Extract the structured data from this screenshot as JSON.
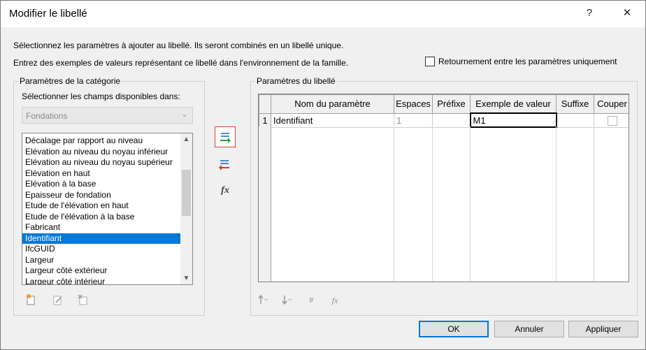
{
  "window": {
    "title": "Modifier le libellé",
    "help_glyph": "?",
    "close_glyph": "✕"
  },
  "instructions": {
    "line1": "Sélectionnez les paramètres à ajouter au libellé. Ils seront combinés en un libellé unique.",
    "line2": "Entrez des exemples de valeurs représentant ce libellé dans l'environnement de la famille."
  },
  "wrap_option": {
    "label": "Retournement entre les paramètres uniquement",
    "checked": false
  },
  "category_panel": {
    "title": "Paramètres de la catégorie",
    "select_label": "Sélectionner les champs disponibles dans:",
    "dropdown_value": "Fondations",
    "items": [
      "Décalage par rapport au niveau",
      "Elévation au niveau du noyau inférieur",
      "Elévation au niveau du noyau supérieur",
      "Elévation en haut",
      "Elévation à la base",
      "Epaisseur de fondation",
      "Etude de l'élévation en haut",
      "Etude de l'élévation à la base",
      "Fabricant",
      "Identifiant",
      "IfcGUID",
      "Largeur",
      "Largeur côté extérieur",
      "Largeur côté intérieur"
    ],
    "selected_item": "Identifiant",
    "toolbar_icons": [
      "new-parameter-icon",
      "edit-parameter-icon",
      "delete-parameter-icon"
    ]
  },
  "middle_buttons": [
    "add-parameter-icon",
    "remove-parameter-icon",
    "fx-formula-icon"
  ],
  "label_panel": {
    "title": "Paramètres du libellé",
    "columns": [
      "Nom du paramètre",
      "Espaces",
      "Préfixe",
      "Exemple de valeur",
      "Suffixe",
      "Couper"
    ],
    "rows": [
      {
        "index": "1",
        "name": "Identifiant",
        "spaces": "1",
        "prefix": "",
        "sample_value": "M1",
        "suffix": "",
        "break": false
      }
    ],
    "toolbar_icons": [
      "move-up-icon",
      "move-down-icon",
      "number-format-icon",
      "fx-edit-icon"
    ]
  },
  "buttons": {
    "ok": "OK",
    "cancel": "Annuler",
    "apply": "Appliquer"
  },
  "colors": {
    "selection": "#0078d7",
    "highlight_border": "#e03c31",
    "add_arrow": "#2e9a44",
    "remove_arrow": "#d83a2a"
  }
}
